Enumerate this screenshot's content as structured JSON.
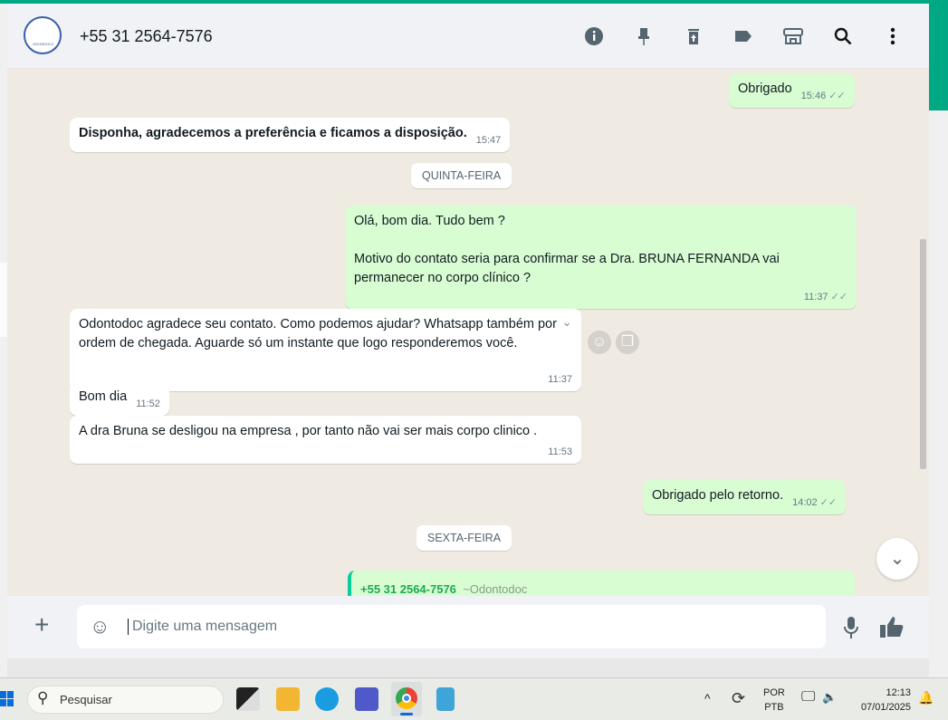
{
  "header": {
    "contact": "+55 31 2564-7576",
    "avatar_text": "ODONDOCC"
  },
  "messages": [
    {
      "dir": "out",
      "text": "Obrigado",
      "time": "15:46"
    },
    {
      "dir": "in",
      "text": "Disponha, agradecemos a preferência e ficamos a disposição.",
      "time": "15:47"
    },
    {
      "dir": "day",
      "text": "QUINTA-FEIRA"
    },
    {
      "dir": "out",
      "line1": "Olá, bom dia. Tudo bem ?",
      "line2": "Motivo do contato seria para confirmar se a Dra.  BRUNA FERNANDA vai permanecer no corpo clínico ?",
      "time": "11:37"
    },
    {
      "dir": "in",
      "text": "Odontodoc agradece seu contato. Como podemos ajudar? Whatsapp também por ordem de chegada. Aguarde só um instante que logo responderemos você.",
      "time": "11:37"
    },
    {
      "dir": "in",
      "text": "Bom dia",
      "time": "11:52"
    },
    {
      "dir": "in",
      "text": "A dra Bruna se desligou na empresa , por tanto não vai ser mais corpo clinico .",
      "time": "11:53"
    },
    {
      "dir": "out",
      "text": "Obrigado pelo retorno.",
      "time": "14:02"
    },
    {
      "dir": "day",
      "text": "SEXTA-FEIRA"
    },
    {
      "dir": "out",
      "sender": "+55 31 2564-7576",
      "name": "~Odontodoc"
    }
  ],
  "footer": {
    "placeholder": "Digite uma mensagem"
  },
  "taskbar": {
    "search": "Pesquisar",
    "lang1": "POR",
    "lang2": "PTB",
    "time": "12:13",
    "date": "07/01/2025"
  },
  "colors": {
    "accent": "#00a884",
    "out_bubble": "#d9fdd3"
  }
}
